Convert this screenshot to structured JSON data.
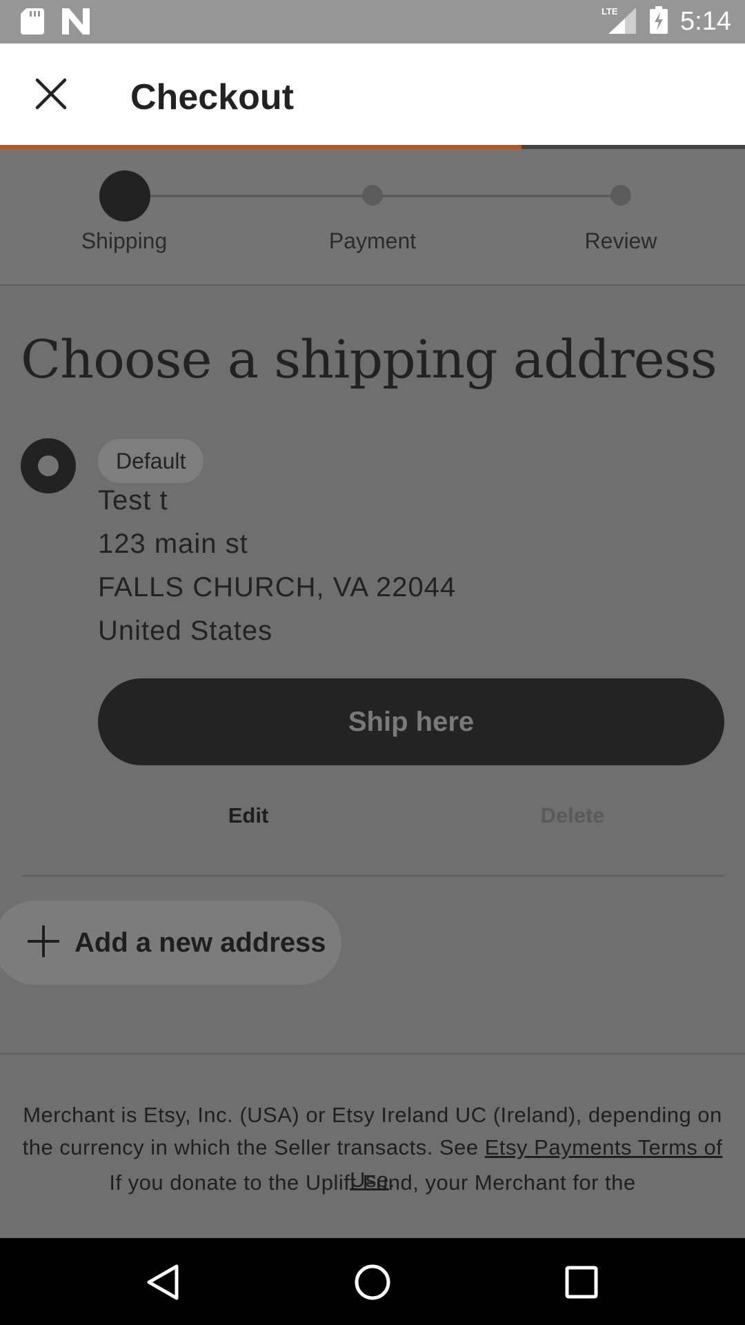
{
  "status_bar": {
    "time": "5:14",
    "network": "LTE",
    "icons": [
      "sd-card-icon",
      "n-notification-icon",
      "signal-icon",
      "battery-charging-icon"
    ]
  },
  "header": {
    "title": "Checkout",
    "close_icon": "close-icon",
    "progress": 0.7
  },
  "stepper": {
    "steps": [
      {
        "label": "Shipping",
        "active": true
      },
      {
        "label": "Payment",
        "active": false
      },
      {
        "label": "Review",
        "active": false
      }
    ]
  },
  "main": {
    "heading": "Choose a shipping address",
    "address": {
      "badge": "Default",
      "name": "Test t",
      "street": "123 main st",
      "city_line": "FALLS CHURCH, VA 22044",
      "country": "United States",
      "selected": true
    },
    "ship_button": "Ship here",
    "edit_button": "Edit",
    "delete_button": "Delete",
    "add_button": "Add a new address"
  },
  "footer": {
    "text_before_link": "Merchant is Etsy, Inc. (USA) or Etsy Ireland UC (Ireland), depending on the currency in which the Seller transacts. See",
    "link": "Etsy Payments Terms of Use",
    "text_after_link": ".",
    "text2": "If you donate to the Uplift Fund, your Merchant for the"
  },
  "colors": {
    "accent": "#b9561b",
    "overlay": "#6f6f6f",
    "dark": "#222222"
  }
}
